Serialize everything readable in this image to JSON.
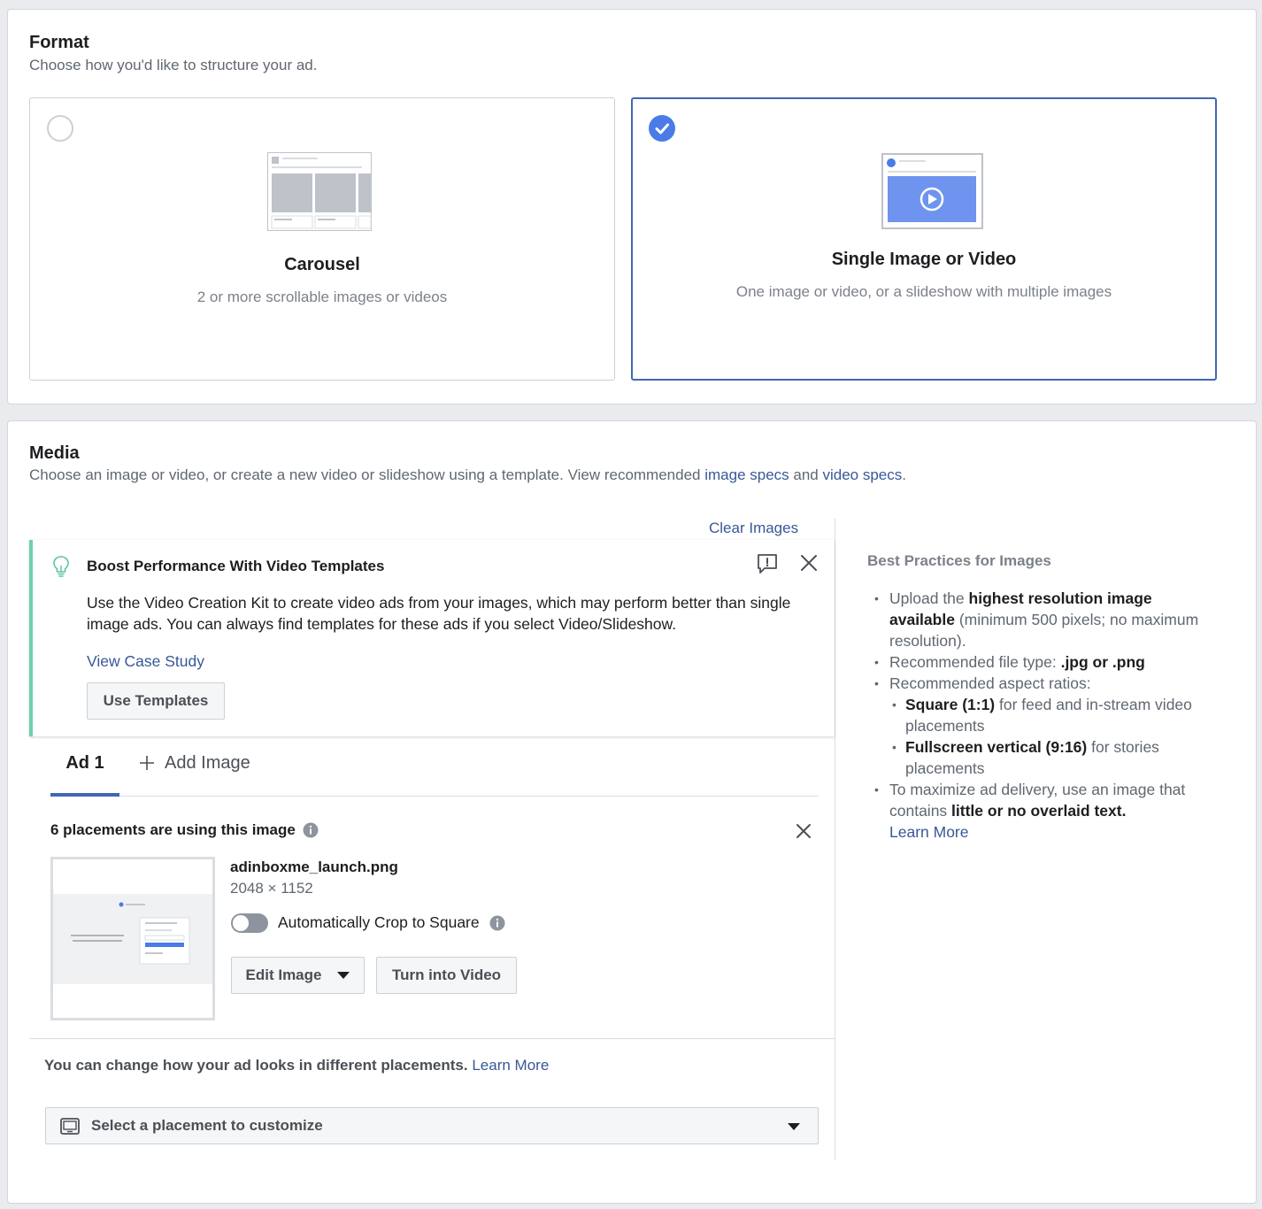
{
  "format": {
    "title": "Format",
    "subtitle": "Choose how you'd like to structure your ad.",
    "options": [
      {
        "title": "Carousel",
        "description": "2 or more scrollable images or videos",
        "selected": false
      },
      {
        "title": "Single Image or Video",
        "description": "One image or video, or a slideshow with multiple images",
        "selected": true
      }
    ]
  },
  "media": {
    "title": "Media",
    "subtitle_prefix": "Choose an image or video, or create a new video or slideshow using a template. View recommended ",
    "image_specs_link": "image specs",
    "subtitle_and": " and ",
    "video_specs_link": "video specs",
    "subtitle_suffix": ".",
    "clear_images": "Clear Images",
    "tip": {
      "title": "Boost Performance With Video Templates",
      "body": "Use the Video Creation Kit to create video ads from your images, which may perform better than single image ads. You can always find templates for these ads if you select Video/Slideshow.",
      "case_study_link": "View Case Study",
      "use_templates_button": "Use Templates"
    },
    "tabs": {
      "active": "Ad 1",
      "add": "Add Image"
    },
    "placements_heading": "6 placements are using this image",
    "file": {
      "name": "adinboxme_launch.png",
      "dimensions": "2048 × 1152"
    },
    "auto_crop": {
      "label": "Automatically Crop to Square",
      "enabled": false
    },
    "edit_image_button": "Edit Image",
    "turn_into_video_button": "Turn into Video",
    "customize_text": "You can change how your ad looks in different placements.",
    "customize_learn_more": "Learn More",
    "placement_select_label": "Select a placement to customize"
  },
  "best_practices": {
    "title": "Best Practices for Images",
    "item1_pre": "Upload the ",
    "item1_bold": "highest resolution image available",
    "item1_post": " (minimum 500 pixels; no maximum resolution).",
    "item2_pre": "Recommended file type: ",
    "item2_bold": ".jpg or .png",
    "item3": "Recommended aspect ratios:",
    "sub1_bold": "Square (1:1)",
    "sub1_post": " for feed and in-stream video placements",
    "sub2_bold": "Fullscreen vertical (9:16)",
    "sub2_post": " for stories placements",
    "item4_pre": "To maximize ad delivery, use an image that contains ",
    "item4_bold": "little or no overlaid text.",
    "learn_more": "Learn More"
  },
  "colors": {
    "accent": "#4267b2",
    "check": "#4a7be8",
    "tip_border": "#6fcfb0",
    "link": "#385898"
  }
}
